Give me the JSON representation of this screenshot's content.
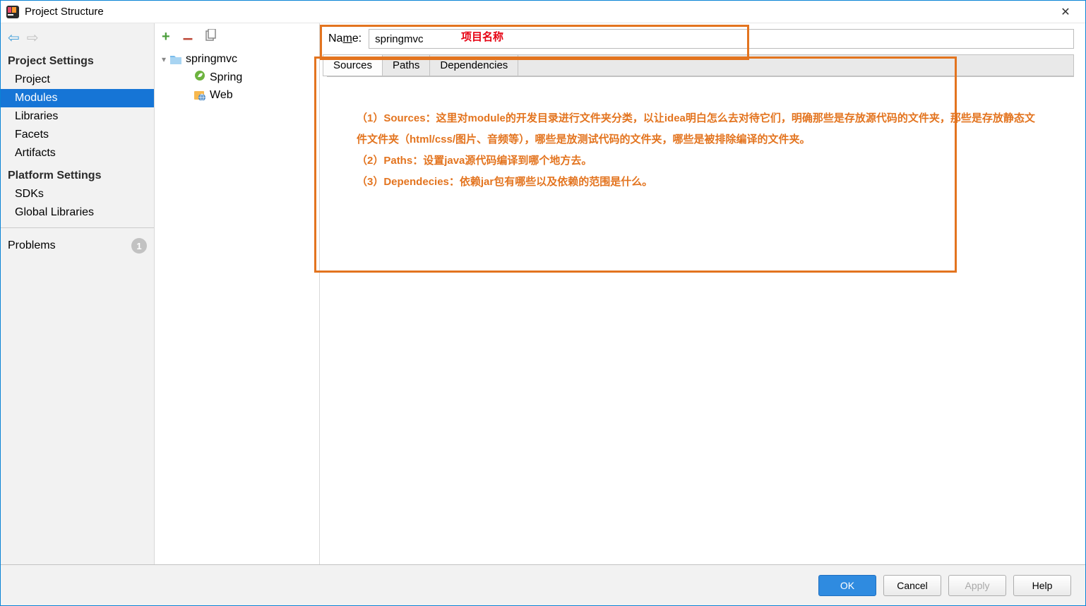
{
  "window": {
    "title": "Project Structure"
  },
  "sidebar": {
    "section1_title": "Project Settings",
    "section1_items": [
      "Project",
      "Modules",
      "Libraries",
      "Facets",
      "Artifacts"
    ],
    "section1_selected_index": 1,
    "section2_title": "Platform Settings",
    "section2_items": [
      "SDKs",
      "Global Libraries"
    ],
    "problems_label": "Problems",
    "problems_count": "1"
  },
  "tree": {
    "root": "springmvc",
    "children": [
      "Spring",
      "Web"
    ]
  },
  "detail": {
    "name_label_prefix": "Na",
    "name_label_underlined": "m",
    "name_label_suffix": "e:",
    "name_value": "springmvc",
    "tabs": [
      "Sources",
      "Paths",
      "Dependencies"
    ],
    "active_tab_index": 0
  },
  "annotations": {
    "title_label": "项目名称",
    "line1": "（1）Sources：这里对module的开发目录进行文件夹分类，以让idea明白怎么去对待它们，明确那些是存放源代码的文件夹，那些是存放静态文件文件夹（html/css/图片、音频等），哪些是放测试代码的文件夹，哪些是被排除编译的文件夹。",
    "line2": "（2）Paths：设置java源代码编译到哪个地方去。",
    "line3": "（3）Dependecies：依赖jar包有哪些以及依赖的范围是什么。"
  },
  "footer": {
    "ok": "OK",
    "cancel": "Cancel",
    "apply": "Apply",
    "help": "Help"
  }
}
